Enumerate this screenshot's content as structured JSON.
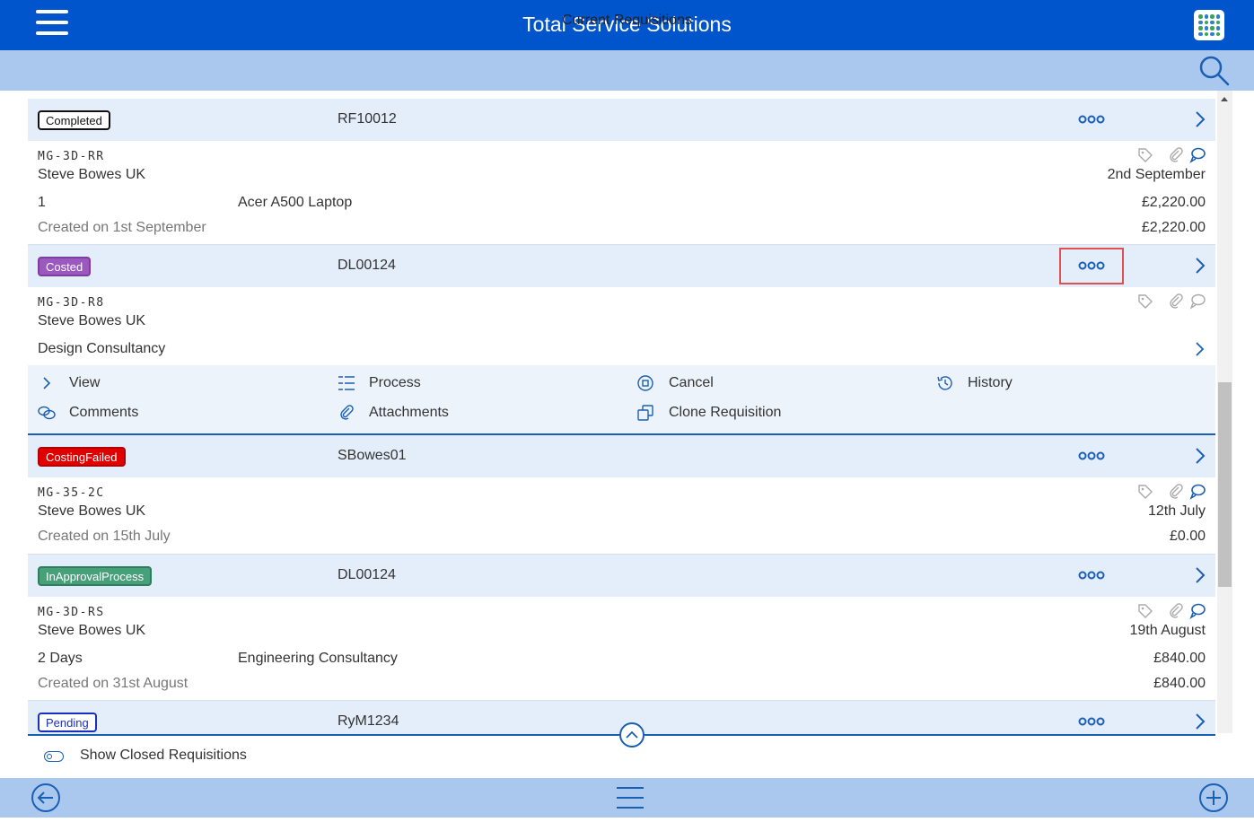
{
  "header": {
    "title": "Total Service Solutions",
    "subtitle": "Current Requisitions"
  },
  "colors": {
    "primary": "#0055cc",
    "subbar": "#aac8ee",
    "row_header": "#e4edfa",
    "accent": "#1a5fb4"
  },
  "requisitions": [
    {
      "status": "Completed",
      "ref": "RF10012",
      "code": "MG-3D-RR",
      "supplier": "Steve Bowes UK",
      "date": "2nd September",
      "qty": "1",
      "description": "Acer A500 Laptop",
      "line_total": "£2,220.00",
      "created": "Created on 1st September",
      "total": "£2,220.00"
    },
    {
      "status": "Costed",
      "ref": "DL00124",
      "code": "MG-3D-R8",
      "supplier": "Steve Bowes UK",
      "description": "Design Consultancy"
    },
    {
      "status": "CostingFailed",
      "ref": "SBowes01",
      "code": "MG-35-2C",
      "supplier": "Steve Bowes UK",
      "date": "12th July",
      "created": "Created on 15th July",
      "total": "£0.00"
    },
    {
      "status": "InApprovalProcess",
      "ref": "DL00124",
      "code": "MG-3D-RS",
      "supplier": "Steve Bowes UK",
      "date": "19th August",
      "qty": "2 Days",
      "description": "Engineering Consultancy",
      "line_total": "£840.00",
      "created": "Created on 31st August",
      "total": "£840.00"
    },
    {
      "status": "Pending",
      "ref": "RyM1234"
    }
  ],
  "actions": {
    "view": "View",
    "process": "Process",
    "cancel": "Cancel",
    "history": "History",
    "comments": "Comments",
    "attachments": "Attachments",
    "clone": "Clone Requisition"
  },
  "footer": {
    "toggle_label": "Show Closed Requisitions"
  }
}
